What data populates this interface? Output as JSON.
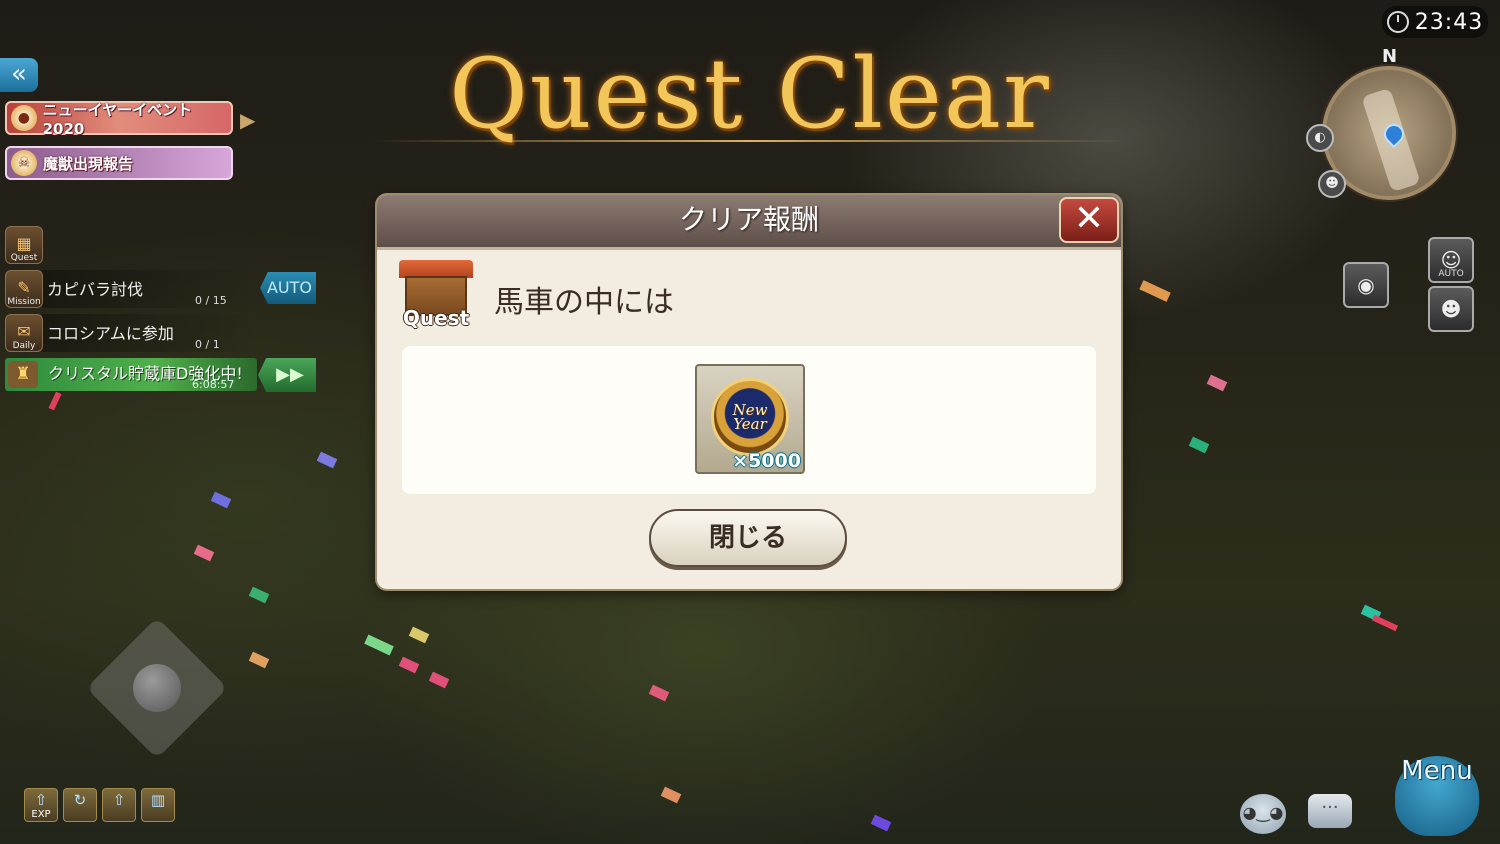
{
  "hud": {
    "clock": "23:43",
    "back_icon": "«",
    "compass_n": "N"
  },
  "left_panel": {
    "banners": [
      {
        "label": "ニューイヤーイベント2020",
        "icon": "daruma-icon"
      },
      {
        "label": "魔獣出現報告",
        "icon": "beast-icon"
      }
    ],
    "missions": [
      {
        "category": "Quest",
        "title": "",
        "count": ""
      },
      {
        "category": "Mission",
        "title": "カピバラ討伐",
        "count": "0 / 15"
      },
      {
        "category": "Daily",
        "title": "コロシアムに参加",
        "count": "0 / 1"
      }
    ],
    "auto_label": "AUTO",
    "crystal": {
      "text": "クリスタル貯蔵庫D強化中!",
      "timer": "6:08:57"
    }
  },
  "title": "Quest Clear",
  "dialog": {
    "header": "クリア報酬",
    "close_icon": "✕",
    "quest_icon_label": "Quest",
    "subtitle": "馬車の中には",
    "reward": {
      "medal_text": "New Year",
      "quantity": "×5000"
    },
    "close_button_label": "閉じる"
  },
  "right_panel": {
    "camera_auto_label": "AUTO",
    "menu_label": "Menu"
  },
  "bottom_buffs": [
    {
      "label": "EXP",
      "icon": "exp-up-icon"
    },
    {
      "label": "",
      "icon": "refresh-buff-icon"
    },
    {
      "label": "",
      "icon": "drop-up-icon"
    },
    {
      "label": "",
      "icon": "gauge-up-icon"
    }
  ],
  "colors": {
    "title_gold": "#f3c65a",
    "dialog_bg": "#f2ede0",
    "close_red": "#c44a3f",
    "mission_auto_blue": "#2b8db3",
    "crystal_green": "#4fb04b"
  }
}
